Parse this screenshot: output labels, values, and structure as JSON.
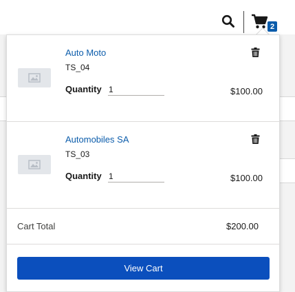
{
  "header": {
    "search_icon": "search-icon",
    "cart_icon": "cart-icon",
    "cart_count": "2"
  },
  "cart": {
    "items": [
      {
        "name": "Auto Moto",
        "sku": "TS_04",
        "quantity_label": "Quantity",
        "quantity": "1",
        "price": "$100.00",
        "image_icon": "image-placeholder-icon",
        "delete_icon": "trash-icon"
      },
      {
        "name": "Automobiles SA",
        "sku": "TS_03",
        "quantity_label": "Quantity",
        "quantity": "1",
        "price": "$100.00",
        "image_icon": "image-placeholder-icon",
        "delete_icon": "trash-icon"
      }
    ],
    "total_label": "Cart Total",
    "total_value": "$200.00",
    "view_cart_label": "View Cart"
  },
  "colors": {
    "link": "#0b5cab",
    "primary_button": "#0b4fbd",
    "badge": "#0b5cab"
  }
}
